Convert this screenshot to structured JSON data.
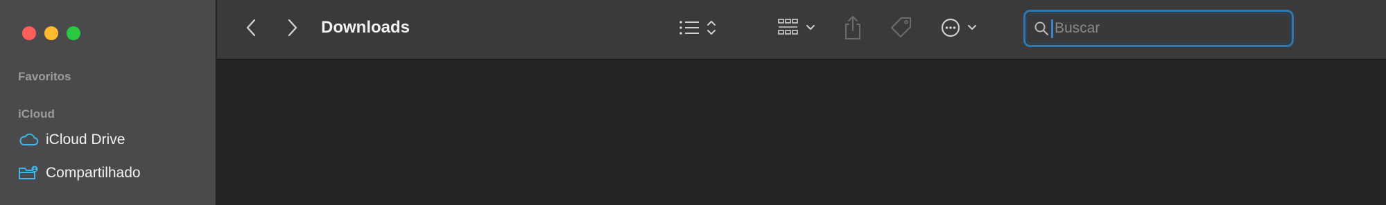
{
  "window": {
    "title": "Downloads"
  },
  "sidebar": {
    "sections": [
      {
        "header": "Favoritos",
        "items": []
      },
      {
        "header": "iCloud",
        "items": [
          {
            "label": "iCloud Drive",
            "icon": "cloud-icon"
          },
          {
            "label": "Compartilhado",
            "icon": "shared-folder-icon"
          }
        ]
      }
    ]
  },
  "toolbar": {
    "search_placeholder": "Buscar",
    "icons": [
      "back-chevron-icon",
      "forward-chevron-icon",
      "list-view-icon",
      "group-icon",
      "share-icon",
      "tag-icon",
      "more-icon"
    ]
  },
  "colors": {
    "accent": "#2f78b0",
    "sidebar_icon": "#3fb6e8"
  }
}
